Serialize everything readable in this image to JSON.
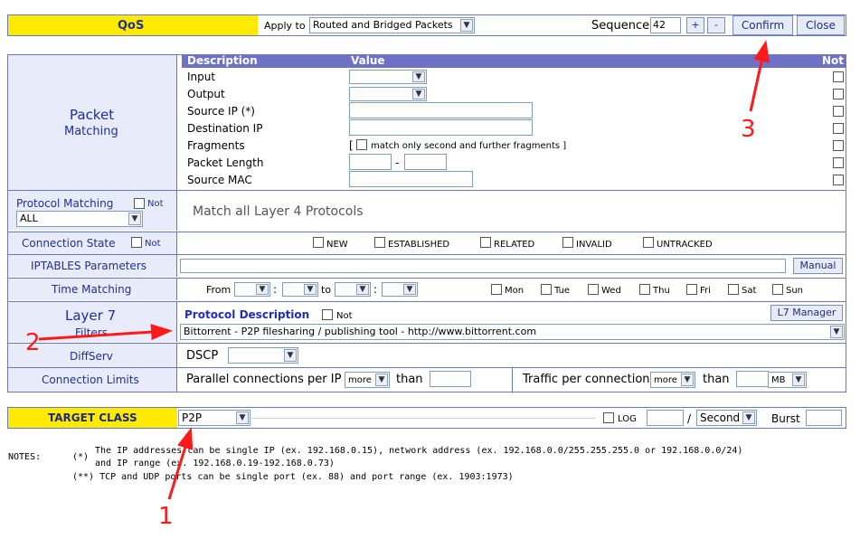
{
  "header": {
    "title": "QoS",
    "apply_label": "Apply to",
    "apply_value": "Routed and Bridged Packets",
    "sequence_label": "Sequence",
    "sequence_value": "42",
    "plus_label": "+",
    "minus_label": "-",
    "confirm_label": "Confirm",
    "close_label": "Close"
  },
  "packet": {
    "title_line1": "Packet",
    "title_line2": "Matching",
    "col_description": "Description",
    "col_value": "Value",
    "col_not": "Not",
    "rows": [
      {
        "label": "Input"
      },
      {
        "label": "Output"
      },
      {
        "label": "Source IP (*)"
      },
      {
        "label": "Destination IP"
      },
      {
        "label": "Fragments"
      },
      {
        "label": "Packet Length"
      },
      {
        "label": "Source MAC"
      }
    ],
    "fragments_text": "match only second and further fragments ]",
    "fragments_bracket": "[",
    "length_dash": "-"
  },
  "protocol": {
    "label": "Protocol Matching",
    "not_label": "Not",
    "select_value": "ALL",
    "description": "Match all Layer 4 Protocols"
  },
  "connection_state": {
    "label": "Connection State",
    "not_label": "Not",
    "options": [
      "NEW",
      "ESTABLISHED",
      "RELATED",
      "INVALID",
      "UNTRACKED"
    ]
  },
  "iptables": {
    "label": "IPTABLES Parameters",
    "manual_label": "Manual"
  },
  "time": {
    "label": "Time Matching",
    "from_label": "From",
    "to_label": "to",
    "colon": ":",
    "days": [
      "Mon",
      "Tue",
      "Wed",
      "Thu",
      "Fri",
      "Sat",
      "Sun"
    ]
  },
  "layer7": {
    "title_line1": "Layer 7",
    "title_line2": "Filters",
    "protocol_desc_label": "Protocol Description",
    "not_label": "Not",
    "manager_label": "L7 Manager",
    "selected": "Bittorrent - P2P filesharing / publishing tool - http://www.bittorrent.com"
  },
  "diffserv": {
    "label": "DiffServ",
    "dscp_label": "DSCP"
  },
  "limits": {
    "label": "Connection Limits",
    "parallel_label": "Parallel connections per IP",
    "more_value": "more",
    "than_label": "than",
    "traffic_label": "Traffic per connection",
    "unit_value": "MB"
  },
  "target": {
    "label": "TARGET CLASS",
    "value": "P2P",
    "log_label": "LOG",
    "slash": "/",
    "rate_unit": "Second",
    "burst_label": "Burst"
  },
  "notes": {
    "title": "NOTES:",
    "star1": "(*)",
    "line1": "The IP addresses can be single IP (ex. 192.168.0.15), network address (ex. 192.168.0.0/255.255.255.0 or 192.168.0.0/24)",
    "line2": "and IP range (ex. 192.168.0.19-192.168.0.73)",
    "line3": "(**) TCP and UDP ports can be single port (ex. 88) and port range (ex. 1903:1973)"
  },
  "annotations": {
    "n1": "1",
    "n2": "2",
    "n3": "3",
    "color": "#ff1a1a"
  }
}
